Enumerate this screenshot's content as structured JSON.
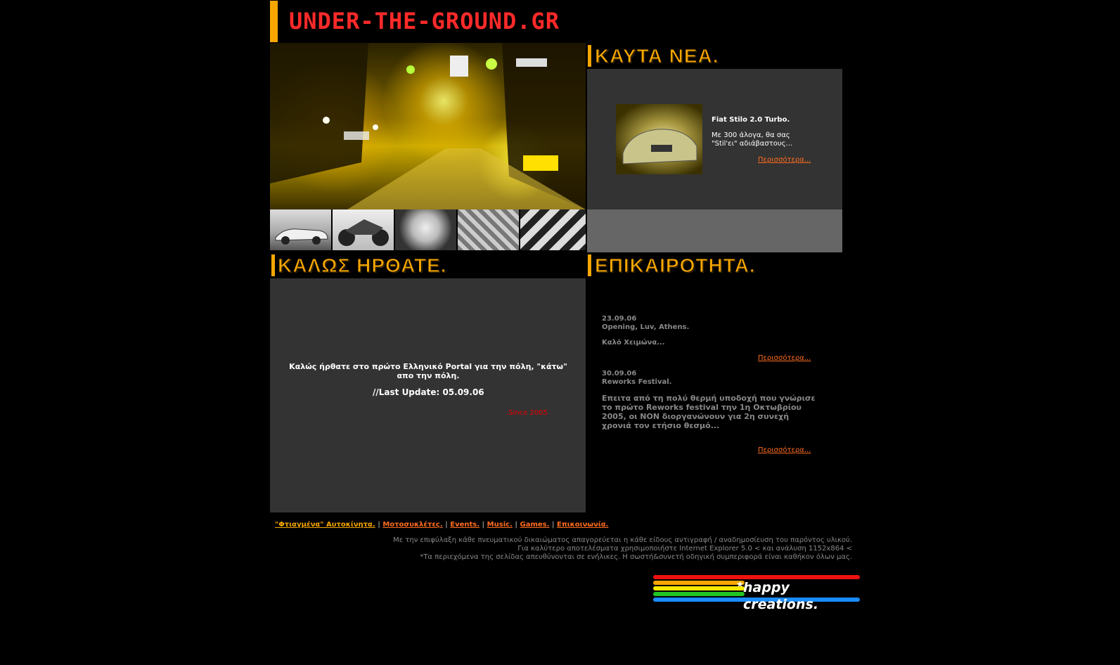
{
  "header": {
    "logo_text": "UNDER-THE-GROUND.GR"
  },
  "hot_news": {
    "title": "ΚΑΥΤΑ ΝΕΑ.",
    "item_title": "Fiat Stilo 2.0 Turbo.",
    "item_text": "Με 300 άλογα, θα σας \"Stil'ει\" αδιάβαστους...",
    "more_label": "Περισσότερα..."
  },
  "welcome": {
    "title": "ΚΑΛΩΣ ΗΡΘΑΤΕ.",
    "message": "Καλώς ήρθατε στο πρώτο Ελληνικό Portal για την πόλη, \"κάτω\" απο την πόλη.",
    "update": "//Last Update: 05.09.06",
    "since": ".Since 2005"
  },
  "current": {
    "title": "ΕΠΙΚΑΙΡΟΤΗΤΑ.",
    "events": [
      {
        "date": "23.09.06",
        "headline": "Opening, Luv, Athens.",
        "text": "Καλό Χειμώνα...",
        "more_label": "Περισσότερα..."
      },
      {
        "date": "30.09.06",
        "headline": "Reworks Festival.",
        "text": "Επειτα από τη πολύ θερμή υποδοχή που γνώρισε το πρώτο Reworks festival την 1η Οκτωβρίου 2005, οι NON διοργανώνουν για 2η συνεχή χρονιά τον ετήσιο θεσμό...",
        "more_label": "Περισσότερα..."
      }
    ]
  },
  "nav": {
    "items": [
      "\"Φτιαγμένα\" Αυτοκίνητα.",
      "Μοτοσυκλέτες.",
      "Events.",
      "Music.",
      "Games.",
      "Επικοινωνία."
    ],
    "separator": "|"
  },
  "footer": {
    "line1": "Με την επιφύλαξη κάθε πνευματικού δικαιώματος απαγορεύεται η κάθε είδους αντιγραφή / αναδημοσίευση του παρόντος υλικού.",
    "line2": "Για καλύτερο αποτελέσματα χρησιμοποιήστε Internet Explorer 5.0 < και ανάλυση 1152x864 <",
    "line3": "*Τα περιεχόμενα της σελίδας απευθύνονται σε ενήλικες. Η σωστή&συνετή οδηγική συμπεριφορά είναι καθήκον όλων μας.",
    "credit": "happy creations."
  },
  "colors": {
    "accent_orange": "#f7a700",
    "logo_red": "#ff2a2a",
    "link_orange": "#ff6d1f",
    "panel_dark": "#333333",
    "panel_grey": "#666666"
  }
}
